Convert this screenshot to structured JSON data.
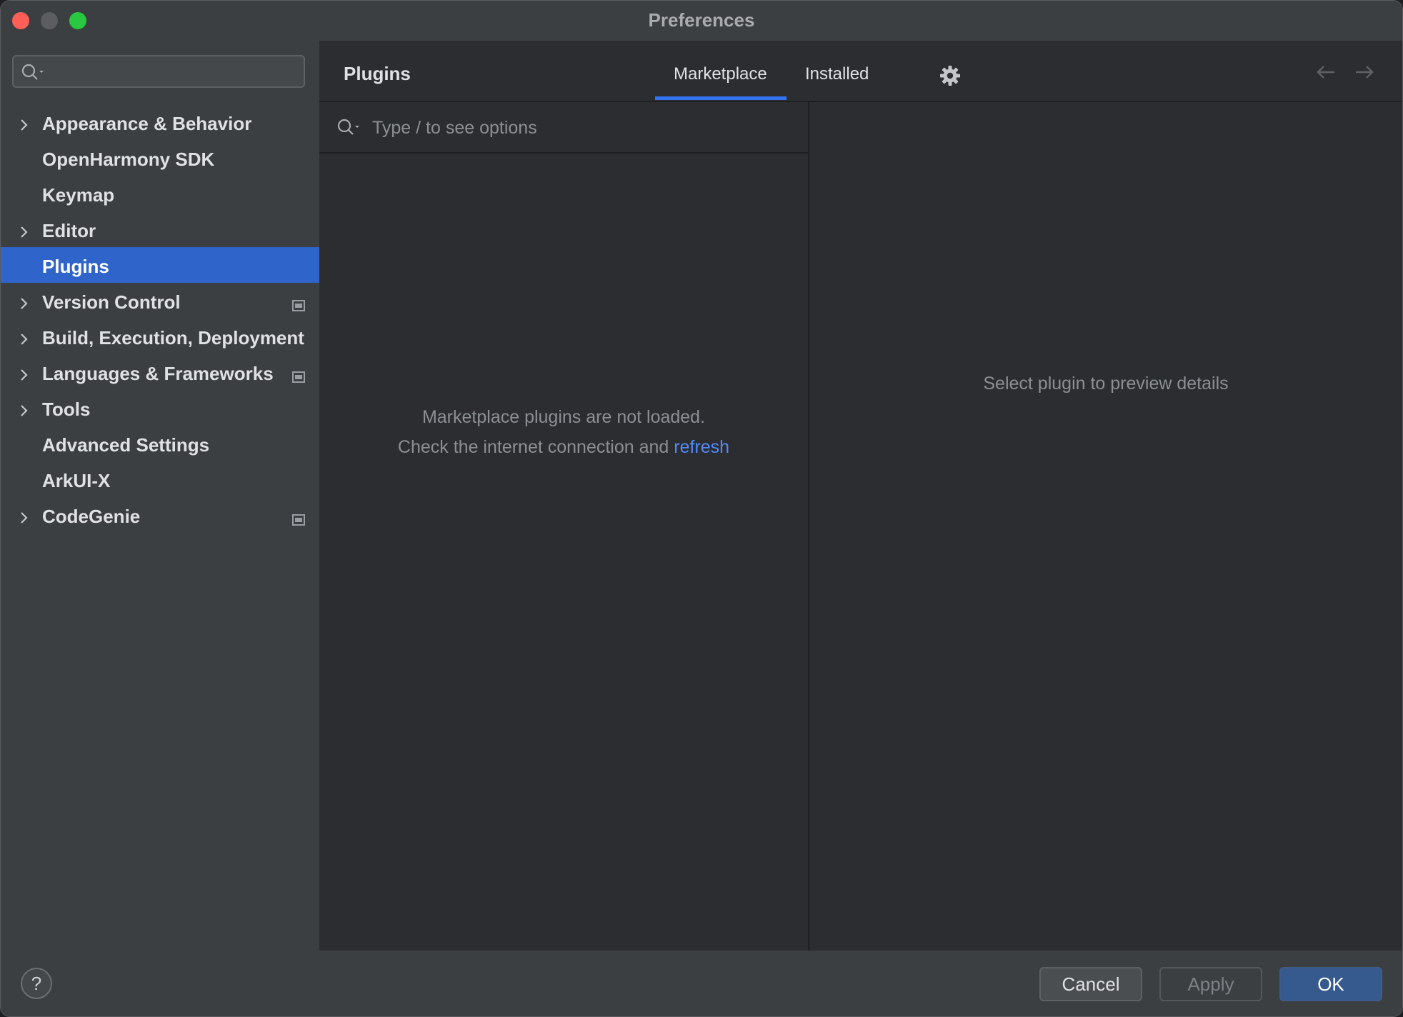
{
  "window": {
    "title": "Preferences"
  },
  "sidebar": {
    "search_placeholder": "",
    "items": [
      {
        "label": "Appearance & Behavior",
        "expandable": true,
        "badge": false,
        "selected": false
      },
      {
        "label": "OpenHarmony SDK",
        "expandable": false,
        "badge": false,
        "selected": false
      },
      {
        "label": "Keymap",
        "expandable": false,
        "badge": false,
        "selected": false
      },
      {
        "label": "Editor",
        "expandable": true,
        "badge": false,
        "selected": false
      },
      {
        "label": "Plugins",
        "expandable": false,
        "badge": false,
        "selected": true
      },
      {
        "label": "Version Control",
        "expandable": true,
        "badge": true,
        "selected": false
      },
      {
        "label": "Build, Execution, Deployment",
        "expandable": true,
        "badge": false,
        "selected": false
      },
      {
        "label": "Languages & Frameworks",
        "expandable": true,
        "badge": true,
        "selected": false
      },
      {
        "label": "Tools",
        "expandable": true,
        "badge": false,
        "selected": false
      },
      {
        "label": "Advanced Settings",
        "expandable": false,
        "badge": false,
        "selected": false
      },
      {
        "label": "ArkUI-X",
        "expandable": false,
        "badge": false,
        "selected": false
      },
      {
        "label": "CodeGenie",
        "expandable": true,
        "badge": true,
        "selected": false
      }
    ]
  },
  "main": {
    "title": "Plugins",
    "tabs": [
      {
        "label": "Marketplace",
        "active": true
      },
      {
        "label": "Installed",
        "active": false
      }
    ],
    "search_placeholder": "Type / to see options",
    "empty_line1": "Marketplace plugins are not loaded.",
    "empty_line2": "Check the internet connection and",
    "refresh_link": "refresh",
    "detail_message": "Select plugin to preview details"
  },
  "footer": {
    "help_label": "?",
    "cancel_label": "Cancel",
    "apply_label": "Apply",
    "ok_label": "OK"
  },
  "colors": {
    "accent": "#3574f0",
    "selection": "#2f65ca",
    "link": "#548af7"
  }
}
